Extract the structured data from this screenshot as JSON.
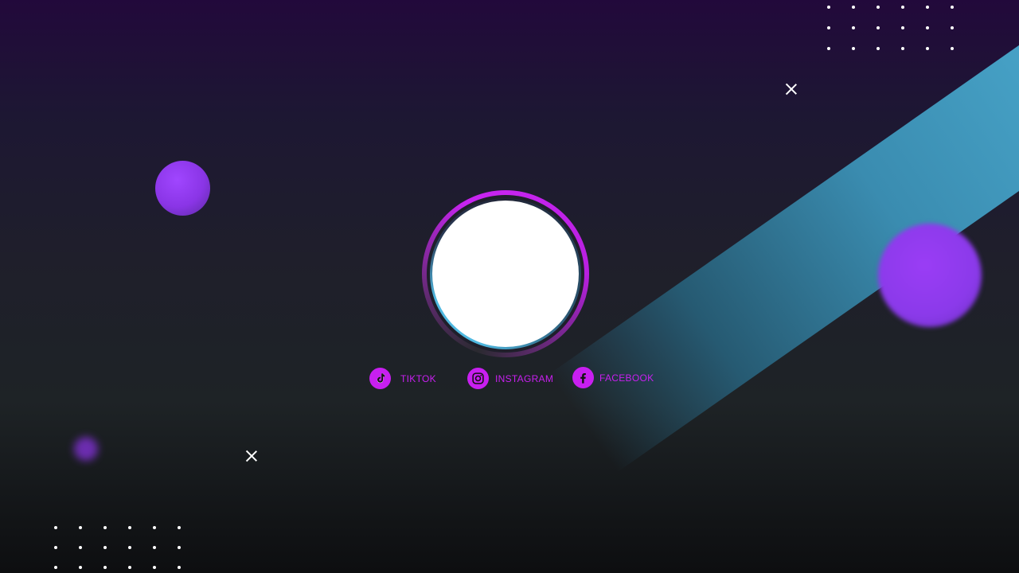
{
  "social_links": [
    {
      "label": "TIKTOK",
      "icon": "tiktok-icon"
    },
    {
      "label": "INSTAGRAM",
      "icon": "instagram-icon"
    },
    {
      "label": "FACEBOOK",
      "icon": "facebook-icon"
    }
  ],
  "colors": {
    "accent": "#c81ff0",
    "orb": "#8b3aea",
    "stripe": "#47b4da",
    "background_top": "#22093b",
    "background_bottom": "#0d0e10",
    "avatar_fill": "#ffffff"
  }
}
